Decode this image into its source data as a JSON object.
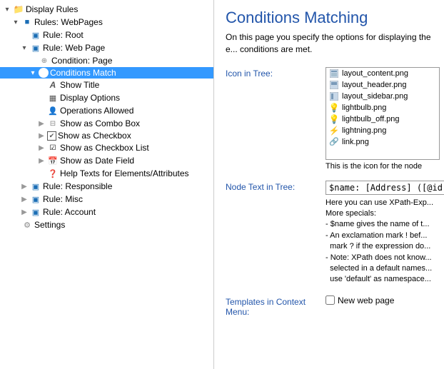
{
  "leftPanel": {
    "items": [
      {
        "id": "display-rules",
        "label": "Display Rules",
        "indent": 0,
        "expand": "open",
        "icon": "folder",
        "selected": false
      },
      {
        "id": "rules-webpages",
        "label": "Rules: WebPages",
        "indent": 1,
        "expand": "open",
        "icon": "folder-blue",
        "selected": false
      },
      {
        "id": "rule-root",
        "label": "Rule: Root",
        "indent": 2,
        "expand": "none",
        "icon": "rule",
        "selected": false
      },
      {
        "id": "rule-webpage",
        "label": "Rule: Web Page",
        "indent": 2,
        "expand": "open",
        "icon": "rule",
        "selected": false
      },
      {
        "id": "condition-page",
        "label": "Condition: Page",
        "indent": 3,
        "expand": "none",
        "icon": "page",
        "selected": false
      },
      {
        "id": "conditions-match",
        "label": "Conditions Match",
        "indent": 3,
        "expand": "open",
        "icon": "check-green",
        "selected": true
      },
      {
        "id": "show-title",
        "label": "Show Title",
        "indent": 4,
        "expand": "none",
        "icon": "text-a",
        "selected": false
      },
      {
        "id": "display-options",
        "label": "Display Options",
        "indent": 4,
        "expand": "none",
        "icon": "display",
        "selected": false
      },
      {
        "id": "operations-allowed",
        "label": "Operations Allowed",
        "indent": 4,
        "expand": "none",
        "icon": "ops",
        "selected": false
      },
      {
        "id": "show-combo",
        "label": "Show as Combo Box",
        "indent": 4,
        "expand": "collapsed",
        "icon": "combo",
        "selected": false
      },
      {
        "id": "show-checkbox",
        "label": "Show as Checkbox",
        "indent": 4,
        "expand": "collapsed",
        "icon": "checkbox-checked",
        "selected": false
      },
      {
        "id": "show-checkbox-list",
        "label": "Show as Checkbox List",
        "indent": 4,
        "expand": "collapsed",
        "icon": "checkbox-list",
        "selected": false
      },
      {
        "id": "show-date",
        "label": "Show as Date Field",
        "indent": 4,
        "expand": "collapsed",
        "icon": "date",
        "selected": false
      },
      {
        "id": "help-texts",
        "label": "Help Texts for Elements/Attributes",
        "indent": 4,
        "expand": "none",
        "icon": "help",
        "selected": false
      },
      {
        "id": "rule-responsible",
        "label": "Rule: Responsible",
        "indent": 2,
        "expand": "collapsed",
        "icon": "rule",
        "selected": false
      },
      {
        "id": "rule-misc",
        "label": "Rule: Misc",
        "indent": 2,
        "expand": "collapsed",
        "icon": "rule",
        "selected": false
      },
      {
        "id": "rule-account",
        "label": "Rule: Account",
        "indent": 2,
        "expand": "collapsed",
        "icon": "rule",
        "selected": false
      },
      {
        "id": "settings",
        "label": "Settings",
        "indent": 1,
        "expand": "none",
        "icon": "settings",
        "selected": false
      }
    ]
  },
  "rightPanel": {
    "title": "Conditions Matching",
    "description": "On this page you specify the options for displaying the e... conditions are met.",
    "iconInTree": {
      "label": "Icon in Tree:",
      "items": [
        {
          "name": "layout_content.png",
          "type": "img"
        },
        {
          "name": "layout_header.png",
          "type": "img"
        },
        {
          "name": "layout_sidebar.png",
          "type": "img"
        },
        {
          "name": "lightbulb.png",
          "type": "yellow"
        },
        {
          "name": "lightbulb_off.png",
          "type": "yellow-off"
        },
        {
          "name": "lightning.png",
          "type": "lightning"
        },
        {
          "name": "link.png",
          "type": "link"
        }
      ],
      "description": "This is the icon for the node"
    },
    "nodeTextInTree": {
      "label": "Node Text in Tree:",
      "value": "$name: [Address] ([@id])",
      "helpText": "Here you can use XPath-Exp...\nMore specials:\n- $name gives the name of t...\n- An exclamation mark ! bef...\n  mark ? if the expression do...\n- Note: XPath does not know...\n  selected in a default names...\n  use 'default' as namespace..."
    },
    "templatesInContextMenu": {
      "label": "Templates in Context Menu:",
      "checkbox": false,
      "checkboxLabel": "New web page"
    }
  }
}
